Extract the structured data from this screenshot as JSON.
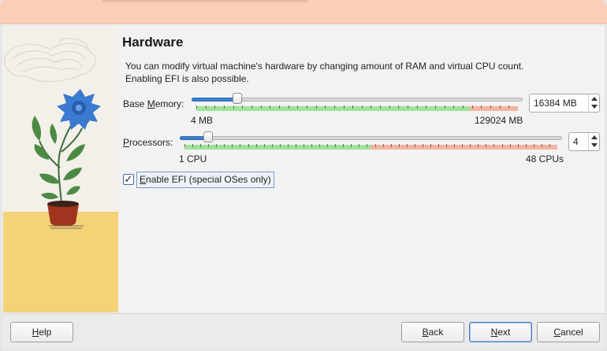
{
  "wizard": {
    "title": "Hardware",
    "description": "You can modify virtual machine's hardware by changing amount of RAM and virtual CPU count. Enabling EFI is also possible."
  },
  "memory": {
    "label_prefix": "Base ",
    "label_mnemonic": "M",
    "label_suffix": "emory:",
    "min_label": "4 MB",
    "max_label": "129024 MB",
    "value": "16384 MB",
    "level": 0.127,
    "safe_fraction": 0.85,
    "colors": {
      "safe": "#9fe39a",
      "warn": "#f4b3a0"
    }
  },
  "processors": {
    "label_mnemonic": "P",
    "label_suffix": "rocessors:",
    "min_label": "1 CPU",
    "max_label": "48 CPUs",
    "value": "4",
    "level": 0.064,
    "safe_fraction": 0.5,
    "colors": {
      "safe": "#9fe39a",
      "warn": "#f4b3a0"
    }
  },
  "efi": {
    "checked": true,
    "check_mark": "✓",
    "label_mnemonic": "E",
    "label_suffix": "nable EFI (special OSes only)"
  },
  "buttons": {
    "help_mnemonic": "H",
    "help_suffix": "elp",
    "back_mnemonic": "B",
    "back_suffix": "ack",
    "next_mnemonic": "N",
    "next_suffix": "ext",
    "cancel_mnemonic": "C",
    "cancel_suffix": "ancel"
  },
  "colors": {
    "titlebar": "#fbcfb7",
    "accent": "#3d7fd0",
    "flower": "#3a7ad0",
    "pot": "#a0341f",
    "table": "#f3d278"
  }
}
